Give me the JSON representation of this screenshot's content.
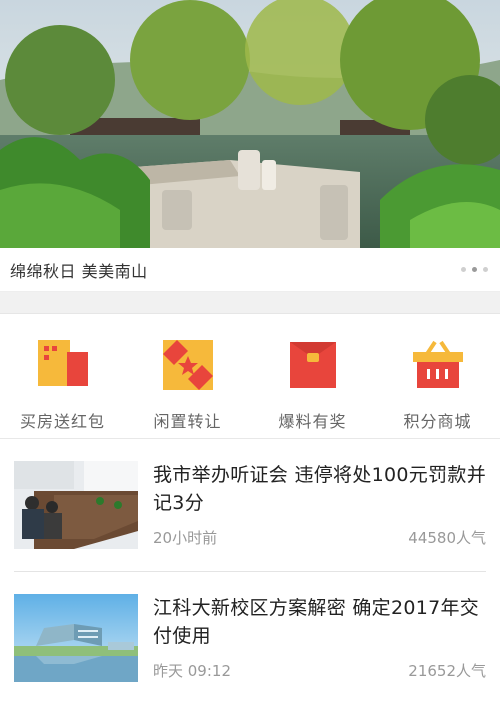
{
  "banner": {
    "caption": "绵绵秋日 美美南山",
    "dots": 3,
    "active_dot": 1
  },
  "quick_entries": [
    {
      "label": "买房送红包",
      "icon": "house-red-packet-icon"
    },
    {
      "label": "闲置转让",
      "icon": "ticket-star-icon"
    },
    {
      "label": "爆料有奖",
      "icon": "red-envelope-icon"
    },
    {
      "label": "积分商城",
      "icon": "shopping-basket-icon"
    }
  ],
  "news": [
    {
      "title": "我市举办听证会 违停将处100元罚款并记3分",
      "time": "20小时前",
      "views": "44580人气"
    },
    {
      "title": "江科大新校区方案解密 确定2017年交付使用",
      "time": "昨天  09:12",
      "views": "21652人气"
    }
  ],
  "colors": {
    "accent_red": "#e8453c",
    "accent_yellow": "#f6b93b",
    "text_dark": "#222222",
    "text_gray": "#999999"
  }
}
